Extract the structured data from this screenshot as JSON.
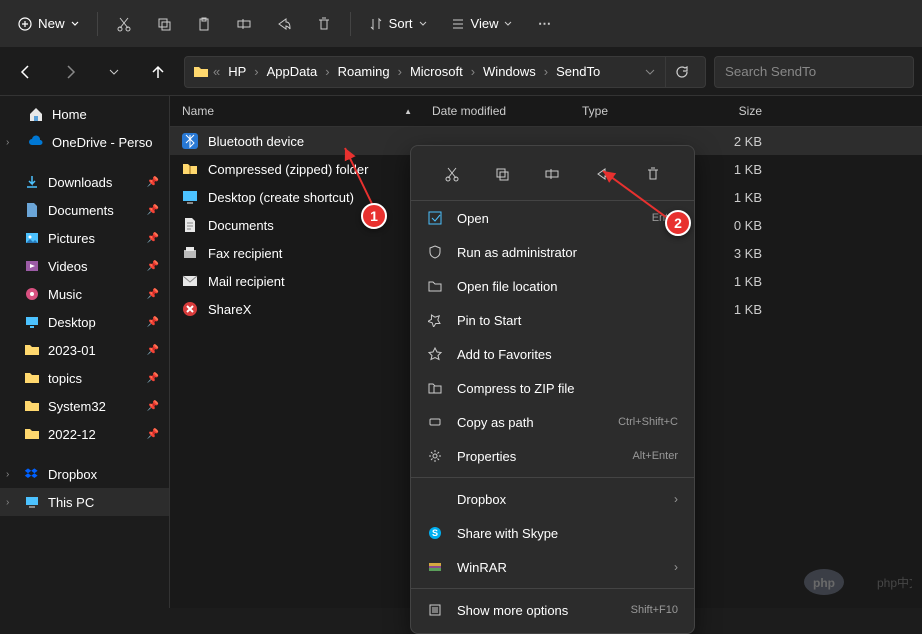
{
  "toolbar": {
    "new_label": "New",
    "sort_label": "Sort",
    "view_label": "View"
  },
  "breadcrumb": {
    "items": [
      "HP",
      "AppData",
      "Roaming",
      "Microsoft",
      "Windows",
      "SendTo"
    ]
  },
  "search": {
    "placeholder": "Search SendTo"
  },
  "sidebar": {
    "home": "Home",
    "onedrive": "OneDrive - Perso",
    "quick": [
      {
        "label": "Downloads",
        "icon": "download"
      },
      {
        "label": "Documents",
        "icon": "doc"
      },
      {
        "label": "Pictures",
        "icon": "pic"
      },
      {
        "label": "Videos",
        "icon": "vid"
      },
      {
        "label": "Music",
        "icon": "music"
      },
      {
        "label": "Desktop",
        "icon": "desk"
      },
      {
        "label": "2023-01",
        "icon": "folder"
      },
      {
        "label": "topics",
        "icon": "folder"
      },
      {
        "label": "System32",
        "icon": "folder"
      },
      {
        "label": "2022-12",
        "icon": "folder"
      }
    ],
    "dropbox": "Dropbox",
    "thispc": "This PC"
  },
  "columns": {
    "name": "Name",
    "date": "Date modified",
    "type": "Type",
    "size": "Size"
  },
  "files": [
    {
      "name": "Bluetooth device",
      "size": "2 KB",
      "selected": true,
      "icon": "bt"
    },
    {
      "name": "Compressed (zipped) folder",
      "size": "1 KB",
      "icon": "zip"
    },
    {
      "name": "Desktop (create shortcut)",
      "size": "1 KB",
      "icon": "desk"
    },
    {
      "name": "Documents",
      "size": "0 KB",
      "icon": "doclib"
    },
    {
      "name": "Fax recipient",
      "size": "3 KB",
      "icon": "fax"
    },
    {
      "name": "Mail recipient",
      "size": "1 KB",
      "icon": "mail"
    },
    {
      "name": "ShareX",
      "size": "1 KB",
      "icon": "sharex"
    }
  ],
  "context_menu": {
    "open": "Open",
    "open_accel": "Enter",
    "admin": "Run as administrator",
    "location": "Open file location",
    "pin": "Pin to Start",
    "fav": "Add to Favorites",
    "zip": "Compress to ZIP file",
    "copypath": "Copy as path",
    "copypath_accel": "Ctrl+Shift+C",
    "props": "Properties",
    "props_accel": "Alt+Enter",
    "dropbox": "Dropbox",
    "skype": "Share with Skype",
    "winrar": "WinRAR",
    "more": "Show more options",
    "more_accel": "Shift+F10"
  },
  "annotations": {
    "a1": "1",
    "a2": "2"
  },
  "watermark": "php中文网"
}
